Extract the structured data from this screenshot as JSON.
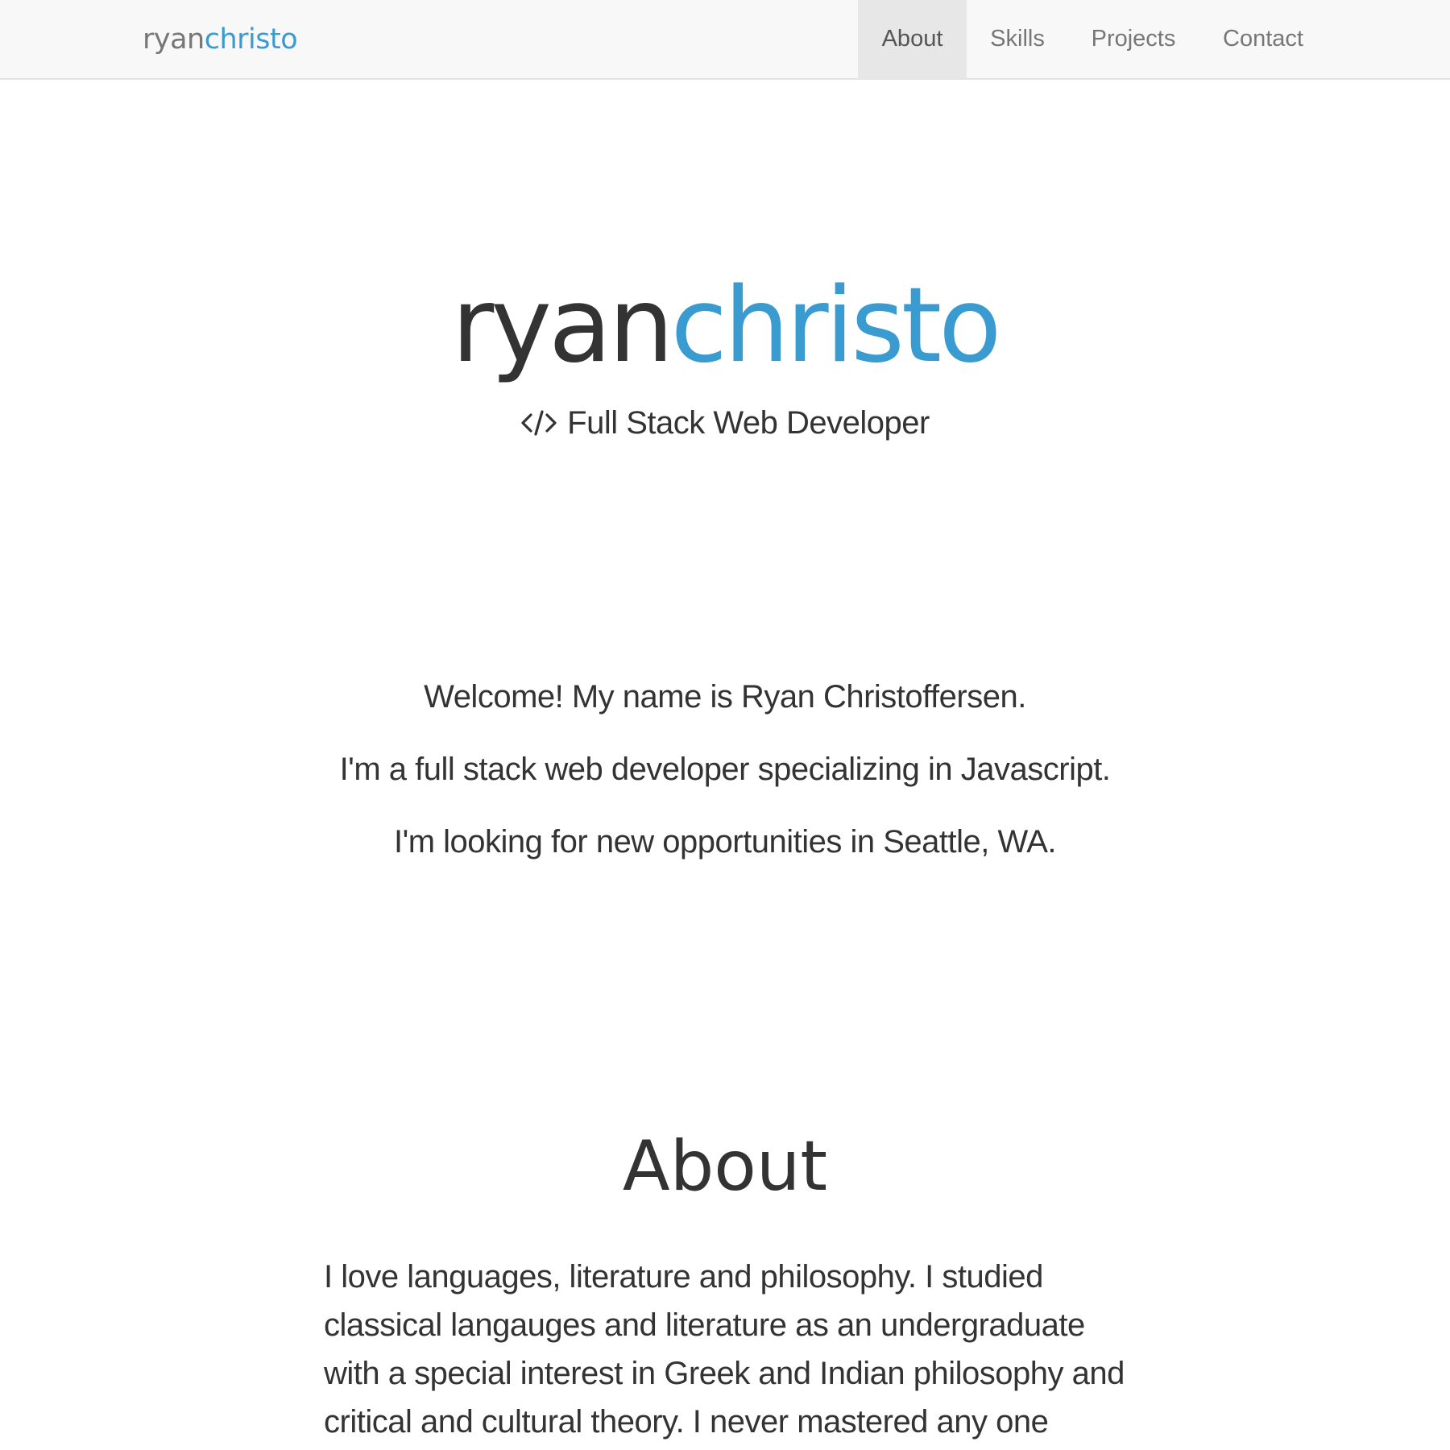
{
  "navbar": {
    "brand_part1": "ryan",
    "brand_part2": "christo",
    "items": [
      {
        "label": "About",
        "active": true
      },
      {
        "label": "Skills",
        "active": false
      },
      {
        "label": "Projects",
        "active": false
      },
      {
        "label": "Contact",
        "active": false
      }
    ]
  },
  "hero": {
    "title_part1": "ryan",
    "title_part2": "christo",
    "subtitle_icon": "code-icon",
    "subtitle": "Full Stack Web Developer"
  },
  "intro": {
    "line1": "Welcome! My name is Ryan Christoffersen.",
    "line2": "I'm a full stack web developer specializing in Javascript.",
    "line3": "I'm looking for new opportunities in Seattle, WA."
  },
  "about": {
    "heading": "About",
    "body": "I love languages, literature and philosophy. I studied classical langauges and literature as an undergraduate with a special interest in Greek and Indian philosophy and critical and cultural theory. I never mastered any one"
  },
  "colors": {
    "accent": "#3a9bd1",
    "text": "#333333",
    "navbar_bg": "#f8f8f8",
    "nav_active_bg": "#e7e7e7",
    "nav_text": "#777777"
  }
}
